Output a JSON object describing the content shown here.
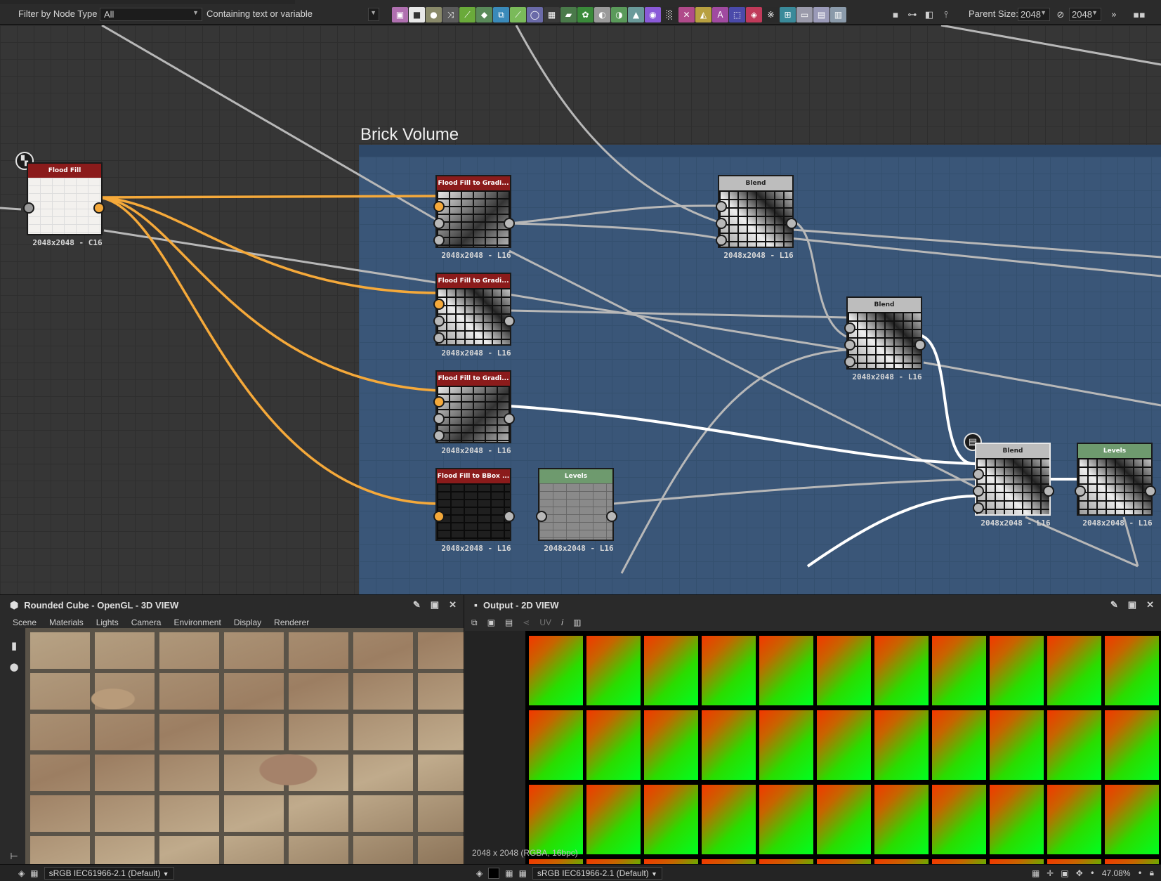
{
  "toolbar": {
    "filter_label": "Filter by Node Type",
    "filter_value": "All",
    "search_placeholder": "Containing text or variable",
    "parent_size_label": "Parent Size:",
    "parent_size_value": "2048",
    "linked_size_value": "2048",
    "more_icon": "chevrons-right-icon"
  },
  "graph": {
    "frame_title": "Brick Volume",
    "nodes": {
      "flood_fill": {
        "title": "Flood Fill",
        "res": "2048x2048 - C16"
      },
      "ff_grad_1": {
        "title": "Flood Fill to Gradi...",
        "res": "2048x2048 - L16"
      },
      "ff_grad_2": {
        "title": "Flood Fill to Gradi...",
        "res": "2048x2048 - L16"
      },
      "ff_grad_3": {
        "title": "Flood Fill to Gradi...",
        "res": "2048x2048 - L16"
      },
      "ff_bbox": {
        "title": "Flood Fill to BBox ...",
        "res": "2048x2048 - L16"
      },
      "levels_1": {
        "title": "Levels",
        "res": "2048x2048 - L16"
      },
      "blend_1": {
        "title": "Blend",
        "res": "2048x2048 - L16"
      },
      "blend_2": {
        "title": "Blend",
        "res": "2048x2048 - L16"
      },
      "blend_3": {
        "title": "Blend",
        "res": "2048x2048 - L16"
      },
      "levels_2": {
        "title": "Levels",
        "res": "2048x2048 - L16"
      }
    },
    "colors": {
      "orange_wire": "#f5a93a",
      "white_wire": "#ffffff",
      "gray_wire": "#b8b8b8",
      "frame_blue": "#3a5678"
    }
  },
  "view3d": {
    "title": "Rounded Cube - OpenGL - 3D VIEW",
    "menu": [
      "Scene",
      "Materials",
      "Lights",
      "Camera",
      "Environment",
      "Display",
      "Renderer"
    ],
    "colorspace": "sRGB IEC61966-2.1 (Default)"
  },
  "view2d": {
    "title": "Output - 2D VIEW",
    "uv_label": "UV",
    "resolution_text": "2048 x 2048 (RGBA, 16bpc)",
    "colorspace": "sRGB IEC61966-2.1 (Default)",
    "zoom": "47.08%"
  }
}
